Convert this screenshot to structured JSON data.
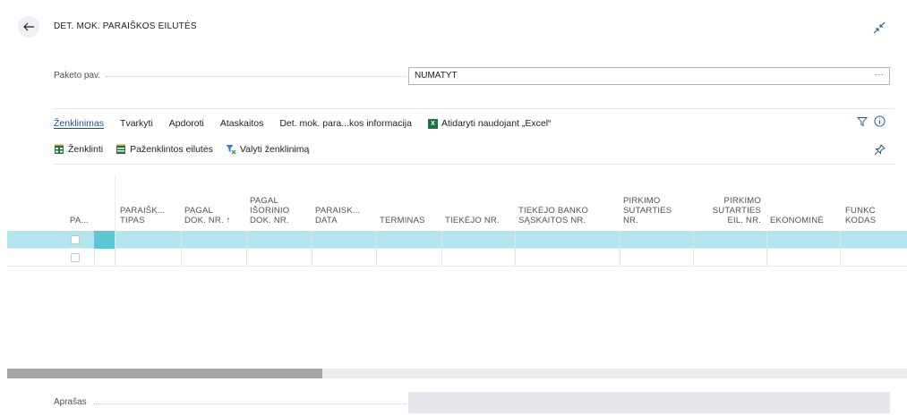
{
  "header": {
    "title": "DET. MOK. PARAIŠKOS EILUTĖS"
  },
  "fields": {
    "package_label": "Paketo pav.",
    "package_value": "NUMATYT",
    "package_ellipsis": "···",
    "description_label": "Aprašas"
  },
  "menu": {
    "items": [
      {
        "label": "Ženklinimas",
        "active": true
      },
      {
        "label": "Tvarkyti"
      },
      {
        "label": "Apdoroti"
      },
      {
        "label": "Ataskaitos"
      },
      {
        "label": "Det. mok. para...kos informacija"
      },
      {
        "label": "Atidaryti naudojant „Excel“",
        "icon": "excel-icon"
      }
    ]
  },
  "actions": {
    "items": [
      {
        "label": "Ženklinti",
        "icon": "mark-icon"
      },
      {
        "label": "Paženklintos eilutės",
        "icon": "marked-lines-icon"
      },
      {
        "label": "Valyti ženklinimą",
        "icon": "clear-filter-icon"
      }
    ]
  },
  "grid": {
    "columns": [
      {
        "label": "PA..."
      },
      {
        "label": "PARAIŠK... TIPAS"
      },
      {
        "label": "PAGAL DOK. NR. ↑"
      },
      {
        "label": "PAGAL IŠORINIO DOK. NR."
      },
      {
        "label": "PARAISK... DATA"
      },
      {
        "label": "TERMINAS"
      },
      {
        "label": "TIEKĖJO NR."
      },
      {
        "label": "TIEKĖJO BANKO SĄSKAITOS NR."
      },
      {
        "label": "PIRKIMO SUTARTIES NR."
      },
      {
        "label": "PIRKIMO SUTARTIES EIL. NR."
      },
      {
        "label": "EKONOMINĖ"
      },
      {
        "label": "FUNKC KODAS"
      }
    ],
    "header_lines": {
      "c0": [
        "PA..."
      ],
      "c1": [
        "PARAIŠK...",
        "TIPAS"
      ],
      "c2": [
        "PAGAL",
        "DOK. NR. ↑"
      ],
      "c3": [
        "PAGAL",
        "IŠORINIO",
        "DOK. NR."
      ],
      "c4": [
        "PARAISK...",
        "DATA"
      ],
      "c5": [
        "TERMINAS"
      ],
      "c6": [
        "TIEKĖJO NR."
      ],
      "c7": [
        "TIEKĖJO BANKO",
        "SĄSKAITOS NR."
      ],
      "c8": [
        "PIRKIMO",
        "SUTARTIES",
        "NR."
      ],
      "c9": [
        "PIRKIMO",
        "SUTARTIES",
        "EIL. NR."
      ],
      "c10": [
        "EKONOMINĖ"
      ],
      "c11": [
        "FUNKC",
        "KODAS"
      ]
    },
    "rows": [
      {
        "selected": true
      },
      {
        "selected": false
      }
    ]
  },
  "colors": {
    "accent": "#1f4e8a",
    "selected_row": "#b2e6ec",
    "active_cell": "#5cc8d6"
  }
}
